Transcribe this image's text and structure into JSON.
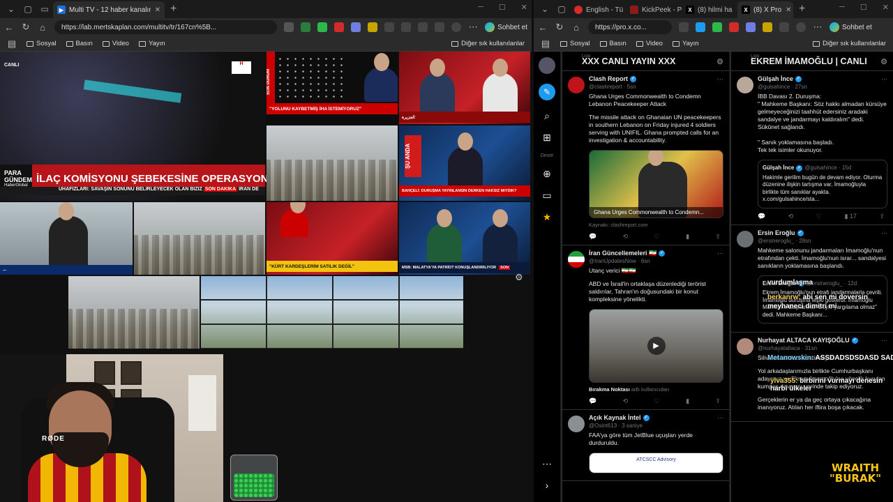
{
  "left_browser": {
    "tabs": [
      {
        "label": "Multi TV - 12 haber kanalını aynı a",
        "active": true
      }
    ],
    "url": "https://lab.mertskaplan.com/multitv/tr/167cn%5B...",
    "sohbet": "Sohbet et",
    "bookmarks": [
      "Sosyal",
      "Basın",
      "Video",
      "Yayın"
    ],
    "other_bookmarks": "Diğer sık kullanılanlar"
  },
  "right_browser": {
    "tabs": [
      {
        "label": "English - Tü",
        "active": false
      },
      {
        "label": "KickPeek - P",
        "active": false
      },
      {
        "label": "(8) hilmi ha",
        "active": false
      },
      {
        "label": "(8) X Pro",
        "active": true
      }
    ],
    "url": "https://pro.x.co...",
    "sohbet": "Sohbet et",
    "bookmarks": [
      "Sosyal",
      "Basın",
      "Video",
      "Yayın"
    ],
    "other_bookmarks": "Diğer sık kullanılanlar"
  },
  "tv": {
    "canli": "CANLI",
    "big_banner_label": "PARA GÜNDEM",
    "big_banner_sub": "HaberGlobal",
    "big_headline": "İLAÇ KOMİSYONU ŞEBEKESİNE OPERASYON",
    "ticker": "UHAFIZLARI: SAVAŞIN SONUNU BELİRLEYECEK OLAN BİZİZ",
    "ticker_tag": "SON DAKİKA",
    "iran": "İRAN DE",
    "son_durum": "SON DURUM",
    "yolunu": "\"YOLUNU KAYBETMİŞ İHA İSTEMİYORUZ\"",
    "su_anda": "ŞU ANDA",
    "bahceli": "BAHÇELİ: DURUŞMA YAYINLANSIN DERKEN HAKSIZ MIYDIK?",
    "kurt": "\"KÜRT KARDEŞLERİM SATILIK DEĞİL\"",
    "msb": "MSB: MALATYA'YA PATRİOT KONUŞLANDIRILIYOR",
    "son": "SON",
    "rode": "RØDE"
  },
  "deck": {
    "col1": {
      "sub": "Liste",
      "title": "XXX CANLI YAYIN XXX",
      "tweets": [
        {
          "name": "Clash Report",
          "handle": "@clashreport · 5sn",
          "text1": "Ghana Urges Commonwealth to Condemn Lebanon Peacekeeper Attack",
          "text2": "The missile attack on Ghanaian UN peacekeepers in southern Lebanon on Friday injured 4 soldiers serving with UNIFIL. Ghana prompted calls for an investigation & accountability.",
          "caption": "Ghana Urges Commonwealth to Condemn...",
          "source": "Kaynakı: clashreport.com"
        },
        {
          "name": "İran Güncellemeleri 🇮🇷",
          "handle": "@IranUpdatesNow · 6sn",
          "text1": "Utanç verici 🇮🇷🇮🇷",
          "text2": "ABD ve İsrail'in ortaklaşa düzenlediği terörist saldırılar, Tahran'ın doğusundaki bir konut kompleksine yönelikti.",
          "source": "Bırakma Noktası",
          "source2": "adlı kullanıcıdan"
        },
        {
          "name": "Açık Kaynak İntel",
          "handle": "@Osint613 · 3 saniye",
          "text1": "FAA'ya göre tüm JetBlue uçuşları yerde durduruldu.",
          "media_label": "ATCSCC Advisory"
        }
      ]
    },
    "col2": {
      "sub": "Liste",
      "title": "EKREM İMAMOĞLU | CANLI",
      "tweets": [
        {
          "name": "Gülşah İnce",
          "handle": "@gulsahince · 27sn",
          "text1": "İBB Davası 2. Duruşma:\n\" Mahkeme Başkanı: Söz hakkı almadan kürsüye gelmeyeceğinizi taahhüt edersiniz aradaki sandalye ve jandarmayı kaldıralım\" dedi. Sükûnet sağlandı.\n\n\" Sanık yoklamasına başladı.\nTek tek isimler okunuyor.",
          "quote_name": "Gülşah İnce",
          "quote_handle": "@gulsahince · 15d",
          "quote_text": "Hakimle gerilim bugün de devam ediyor. Oturma düzenine ilişkin tartışma var. İmamoğluyla birlikte tüm sanıklar ayakta. x.com/gulsahince/sta...",
          "stats": "17"
        },
        {
          "name": "Ersin Eroğlu",
          "handle": "@ersineroglu_ · 28sn",
          "text1": "Mahkeme salonunu jandarmaları İmamoğlu'nun etrafından çekti. İmamoğlu'nun israr... sandalyesi sanıkların yoklamasına başlandı.",
          "quote_name": "Ersin Eroğlu",
          "quote_handle": "@ersineroglu_ · 12d",
          "quote_text": "Ekrem İmamoğlu'nun etrafı jandarmalarla çevrili. İmamoğlu duruşma tepki gösterdi. İmamoğlu Mahkeme Başkanına \"Böyle yargılama olmaz\" dedi. Mahkeme Başkanı..."
        },
        {
          "name": "Nurhayat ALTACA KAYIŞOĞLU",
          "handle": "@nurhayataltaca · 31sn",
          "text1": "Silivri'de adalet nöbetindeyiz!",
          "text2": "Yol arkadaşlarımızla birlikte Cumhurbaşkanı adayımız ve Ekrem İmamoğlu'na yönelik kurulan kumpas davasını yerinde takip ediyoruz.",
          "text3": "Gerçeklerin er ya da geç ortaya çıkacağına inanıyoruz. Atılan her iftira boşa çıkacak."
        }
      ]
    }
  },
  "chat": [
    {
      "user": "",
      "msg": "vurdumlaşma"
    },
    {
      "user": "berkanrw:",
      "msg": "abi sen mi doversin"
    },
    {
      "user": "",
      "msg": "meyhaneci dimitri mi"
    },
    {
      "user": "Metanowskin:",
      "msg": "ASSDADSDSDASD SADASDSAD"
    },
    {
      "user": "ylva355:",
      "msg": "birbirini vurmayı denesin harbi ülkeler"
    }
  ],
  "overlay": {
    "line1": "WRAITH",
    "line2": "\"BURAK\""
  }
}
